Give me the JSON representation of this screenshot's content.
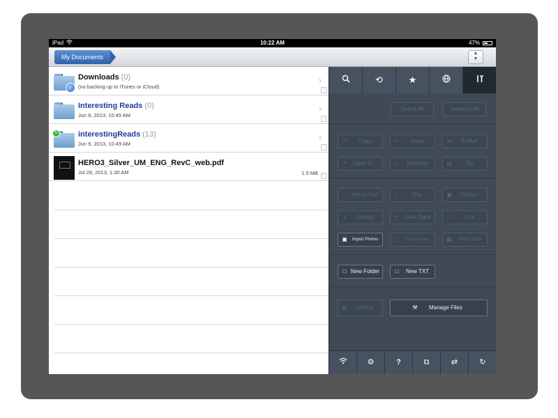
{
  "status_bar": {
    "device": "iPad",
    "time": "10:22 AM",
    "battery": "47%",
    "battery_level": 0.47
  },
  "nav": {
    "breadcrumb": "My Documents",
    "sort_icon": "updown-arrows-icon"
  },
  "files": [
    {
      "name": "Downloads",
      "count": "(0)",
      "meta": "(no backing up to iTunes or iCloud)",
      "type": "folder",
      "badge": "globe"
    },
    {
      "name": "Interesting Reads",
      "count": "(0)",
      "meta": "Jun 9, 2013, 10:45 AM",
      "type": "folder"
    },
    {
      "name": "interestingReads",
      "count": "(13)",
      "meta": "Jun 9, 2013, 10:49 AM",
      "type": "folder",
      "badge": "green"
    },
    {
      "name": "HERO3_Silver_UM_ENG_RevC_web.pdf",
      "meta": "Jul 28, 2013, 1:30 AM",
      "size": "1.5 MB",
      "type": "pdf"
    }
  ],
  "panel": {
    "tabs": [
      "search-icon",
      "history-icon",
      "star-icon",
      "globe-icon",
      "tools-icon"
    ],
    "select_all": "Select All",
    "deselect_all": "Deselect All",
    "copy": "Copy",
    "move": "Move",
    "email": "E-Mail",
    "open_in": "Open In...",
    "rename": "Rename",
    "zip": "Zip",
    "mark_as_read": "Mark as Read",
    "star": "Star",
    "protect": "Protect",
    "upload": "Upload",
    "save_back": "Save Back",
    "link": "Link",
    "import_photos": "Import Photos",
    "save_to_photos": "Save to Photos",
    "fetch_info": "Fetch Info",
    "new_folder": "New Folder",
    "new_txt": "New TXT",
    "delete": "Delete",
    "manage_files": "Manage Files"
  },
  "bottom_bar": [
    "wifi-icon",
    "settings-icon",
    "help-icon",
    "share-icon",
    "sync-icon",
    "refresh-icon"
  ],
  "colors": {
    "panel_bg": "#3f4a56",
    "accent_blue": "#2f63ad",
    "folder_name_blue": "#1f3b9b"
  }
}
